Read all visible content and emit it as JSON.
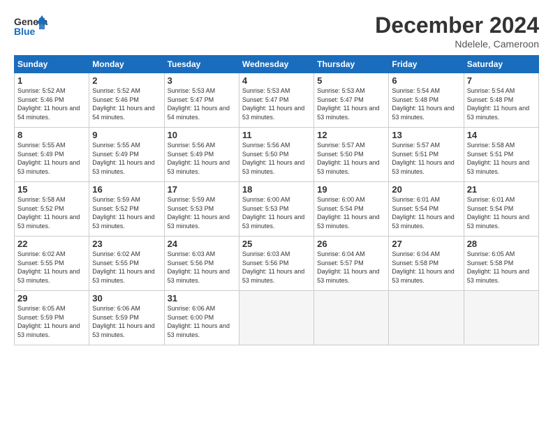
{
  "header": {
    "logo_general": "General",
    "logo_blue": "Blue",
    "title": "December 2024",
    "subtitle": "Ndelele, Cameroon"
  },
  "days_of_week": [
    "Sunday",
    "Monday",
    "Tuesday",
    "Wednesday",
    "Thursday",
    "Friday",
    "Saturday"
  ],
  "weeks": [
    [
      {
        "day": 1,
        "sunrise": "5:52 AM",
        "sunset": "5:46 PM",
        "daylight": "11 hours and 54 minutes."
      },
      {
        "day": 2,
        "sunrise": "5:52 AM",
        "sunset": "5:46 PM",
        "daylight": "11 hours and 54 minutes."
      },
      {
        "day": 3,
        "sunrise": "5:53 AM",
        "sunset": "5:47 PM",
        "daylight": "11 hours and 54 minutes."
      },
      {
        "day": 4,
        "sunrise": "5:53 AM",
        "sunset": "5:47 PM",
        "daylight": "11 hours and 53 minutes."
      },
      {
        "day": 5,
        "sunrise": "5:53 AM",
        "sunset": "5:47 PM",
        "daylight": "11 hours and 53 minutes."
      },
      {
        "day": 6,
        "sunrise": "5:54 AM",
        "sunset": "5:48 PM",
        "daylight": "11 hours and 53 minutes."
      },
      {
        "day": 7,
        "sunrise": "5:54 AM",
        "sunset": "5:48 PM",
        "daylight": "11 hours and 53 minutes."
      }
    ],
    [
      {
        "day": 8,
        "sunrise": "5:55 AM",
        "sunset": "5:49 PM",
        "daylight": "11 hours and 53 minutes."
      },
      {
        "day": 9,
        "sunrise": "5:55 AM",
        "sunset": "5:49 PM",
        "daylight": "11 hours and 53 minutes."
      },
      {
        "day": 10,
        "sunrise": "5:56 AM",
        "sunset": "5:49 PM",
        "daylight": "11 hours and 53 minutes."
      },
      {
        "day": 11,
        "sunrise": "5:56 AM",
        "sunset": "5:50 PM",
        "daylight": "11 hours and 53 minutes."
      },
      {
        "day": 12,
        "sunrise": "5:57 AM",
        "sunset": "5:50 PM",
        "daylight": "11 hours and 53 minutes."
      },
      {
        "day": 13,
        "sunrise": "5:57 AM",
        "sunset": "5:51 PM",
        "daylight": "11 hours and 53 minutes."
      },
      {
        "day": 14,
        "sunrise": "5:58 AM",
        "sunset": "5:51 PM",
        "daylight": "11 hours and 53 minutes."
      }
    ],
    [
      {
        "day": 15,
        "sunrise": "5:58 AM",
        "sunset": "5:52 PM",
        "daylight": "11 hours and 53 minutes."
      },
      {
        "day": 16,
        "sunrise": "5:59 AM",
        "sunset": "5:52 PM",
        "daylight": "11 hours and 53 minutes."
      },
      {
        "day": 17,
        "sunrise": "5:59 AM",
        "sunset": "5:53 PM",
        "daylight": "11 hours and 53 minutes."
      },
      {
        "day": 18,
        "sunrise": "6:00 AM",
        "sunset": "5:53 PM",
        "daylight": "11 hours and 53 minutes."
      },
      {
        "day": 19,
        "sunrise": "6:00 AM",
        "sunset": "5:54 PM",
        "daylight": "11 hours and 53 minutes."
      },
      {
        "day": 20,
        "sunrise": "6:01 AM",
        "sunset": "5:54 PM",
        "daylight": "11 hours and 53 minutes."
      },
      {
        "day": 21,
        "sunrise": "6:01 AM",
        "sunset": "5:54 PM",
        "daylight": "11 hours and 53 minutes."
      }
    ],
    [
      {
        "day": 22,
        "sunrise": "6:02 AM",
        "sunset": "5:55 PM",
        "daylight": "11 hours and 53 minutes."
      },
      {
        "day": 23,
        "sunrise": "6:02 AM",
        "sunset": "5:55 PM",
        "daylight": "11 hours and 53 minutes."
      },
      {
        "day": 24,
        "sunrise": "6:03 AM",
        "sunset": "5:56 PM",
        "daylight": "11 hours and 53 minutes."
      },
      {
        "day": 25,
        "sunrise": "6:03 AM",
        "sunset": "5:56 PM",
        "daylight": "11 hours and 53 minutes."
      },
      {
        "day": 26,
        "sunrise": "6:04 AM",
        "sunset": "5:57 PM",
        "daylight": "11 hours and 53 minutes."
      },
      {
        "day": 27,
        "sunrise": "6:04 AM",
        "sunset": "5:58 PM",
        "daylight": "11 hours and 53 minutes."
      },
      {
        "day": 28,
        "sunrise": "6:05 AM",
        "sunset": "5:58 PM",
        "daylight": "11 hours and 53 minutes."
      }
    ],
    [
      {
        "day": 29,
        "sunrise": "6:05 AM",
        "sunset": "5:59 PM",
        "daylight": "11 hours and 53 minutes."
      },
      {
        "day": 30,
        "sunrise": "6:06 AM",
        "sunset": "5:59 PM",
        "daylight": "11 hours and 53 minutes."
      },
      {
        "day": 31,
        "sunrise": "6:06 AM",
        "sunset": "6:00 PM",
        "daylight": "11 hours and 53 minutes."
      },
      null,
      null,
      null,
      null
    ]
  ]
}
